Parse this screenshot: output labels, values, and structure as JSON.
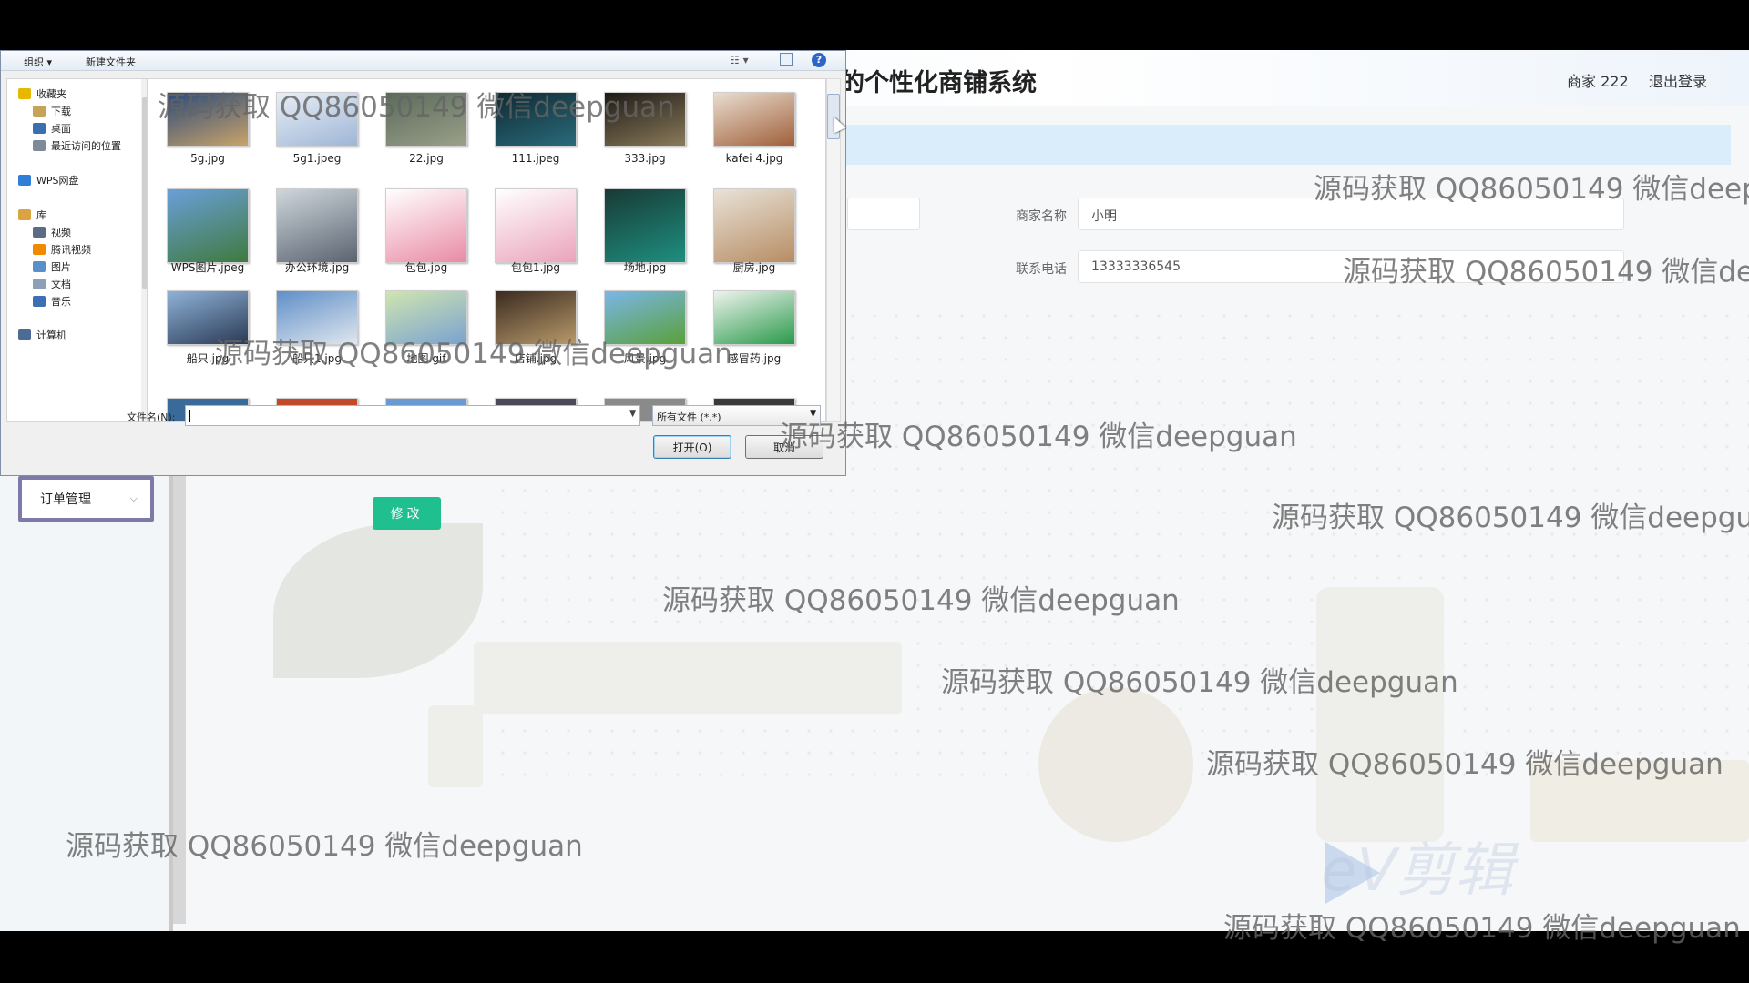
{
  "header": {
    "title": "的个性化商铺系统",
    "user": "商家 222",
    "logout": "退出登录"
  },
  "form": {
    "merchant_name_label": "商家名称",
    "merchant_name_value": "小明",
    "phone_label": "联系电话",
    "phone_value": "13333336545",
    "edit_button": "修改"
  },
  "sidebar": {
    "order_menu": "订单管理"
  },
  "dialog": {
    "toolbar": {
      "organize": "组织 ▾",
      "new_folder": "新建文件夹",
      "help": "?"
    },
    "nav": [
      {
        "label": "收藏夹",
        "icon": "star-icon",
        "color": "#e6b800"
      },
      {
        "label": "下载",
        "icon": "download-folder-icon",
        "color": "#c9a25a"
      },
      {
        "label": "桌面",
        "icon": "desktop-icon",
        "color": "#3a6fb0"
      },
      {
        "label": "最近访问的位置",
        "icon": "recent-places-icon",
        "color": "#7f8a99"
      },
      {
        "label": "WPS网盘",
        "icon": "cloud-icon",
        "color": "#2f7ed8"
      },
      {
        "label": "库",
        "icon": "library-icon",
        "color": "#d9a441"
      },
      {
        "label": "视频",
        "icon": "video-icon",
        "color": "#5b6d86"
      },
      {
        "label": "腾讯视频",
        "icon": "tencent-video-icon",
        "color": "#f08a00"
      },
      {
        "label": "图片",
        "icon": "pictures-icon",
        "color": "#5b8fc7"
      },
      {
        "label": "文档",
        "icon": "documents-icon",
        "color": "#8da0b8"
      },
      {
        "label": "音乐",
        "icon": "music-icon",
        "color": "#3d6fb6"
      },
      {
        "label": "计算机",
        "icon": "computer-icon",
        "color": "#4d6b94"
      }
    ],
    "files": [
      {
        "name": "5g.jpg",
        "c1": "#2a4a7a",
        "c2": "#c9a36a"
      },
      {
        "name": "5g1.jpeg",
        "c1": "#e8eef6",
        "c2": "#9fb6d6"
      },
      {
        "name": "22.jpg",
        "c1": "#5a6a5a",
        "c2": "#9aa08a"
      },
      {
        "name": "111.jpeg",
        "c1": "#0f2a33",
        "c2": "#2a6a7a"
      },
      {
        "name": "333.jpg",
        "c1": "#1d1a15",
        "c2": "#8a7a5a"
      },
      {
        "name": "kafei 4.jpg",
        "c1": "#e9ddd0",
        "c2": "#a0603a"
      },
      {
        "name": "WPS图片.jpeg",
        "c1": "#6a9fd8",
        "c2": "#3f7a3f"
      },
      {
        "name": "办公环境.jpg",
        "c1": "#cfd6dc",
        "c2": "#5a6470"
      },
      {
        "name": "包包.jpg",
        "c1": "#ffffff",
        "c2": "#e98aa5"
      },
      {
        "name": "包包1.jpg",
        "c1": "#ffffff",
        "c2": "#eaa3bb"
      },
      {
        "name": "场地.jpg",
        "c1": "#183a36",
        "c2": "#1e8f7f"
      },
      {
        "name": "厨房.jpg",
        "c1": "#e8e2d8",
        "c2": "#b78d63"
      },
      {
        "name": "船只.jpg",
        "c1": "#8fb2d8",
        "c2": "#2a3a55"
      },
      {
        "name": "船只1.jpg",
        "c1": "#5f8fc8",
        "c2": "#e0e6ee"
      },
      {
        "name": "地图.gif",
        "c1": "#cfe5b0",
        "c2": "#7aa2d0"
      },
      {
        "name": "店铺.jpg",
        "c1": "#3a2a20",
        "c2": "#b89a6a"
      },
      {
        "name": "风景.jpg",
        "c1": "#7ab6e8",
        "c2": "#5aa03a"
      },
      {
        "name": "感冒药.jpg",
        "c1": "#eef3ee",
        "c2": "#2a9a4a"
      }
    ],
    "filename_label": "文件名(N):",
    "filename_value": "",
    "filter": "所有文件 (*.*)",
    "open_button": "打开(O)",
    "cancel_button": "取消"
  },
  "watermark": "源码获取 QQ86050149 微信deepguan",
  "watermark_brand": "eV剪辑",
  "colors": {
    "accent_green": "#1fbf8f",
    "subbar_blue": "#d9edfb",
    "menu_border": "#7d7aa8"
  }
}
